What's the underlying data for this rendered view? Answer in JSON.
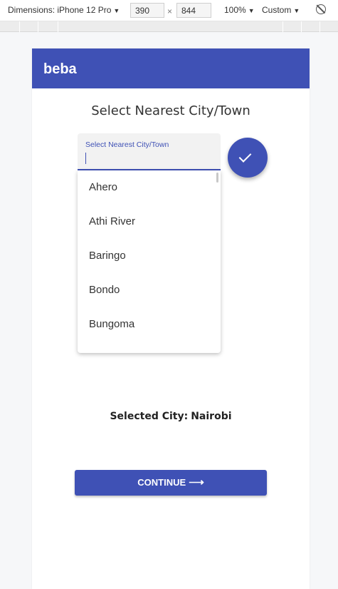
{
  "devtools": {
    "dimensions_label": "Dimensions: iPhone 12 Pro",
    "width": "390",
    "times": "×",
    "height": "844",
    "zoom": "100%",
    "throttle": "Custom",
    "dropdown_caret": "▼",
    "rotate_icon": "rotate-icon"
  },
  "app": {
    "brand": "beba",
    "accent_color": "#3f51b5"
  },
  "page": {
    "heading": "Select Nearest City/Town",
    "field_label": "Select Nearest City/Town",
    "options": [
      "Ahero",
      "Athi River",
      "Baringo",
      "Bondo",
      "Bungoma"
    ],
    "selected_prefix": "Selected City:",
    "selected_city": "Nairobi",
    "continue_label": "CONTINUE",
    "continue_arrow": "⟶",
    "confirm_icon": "check-icon"
  }
}
